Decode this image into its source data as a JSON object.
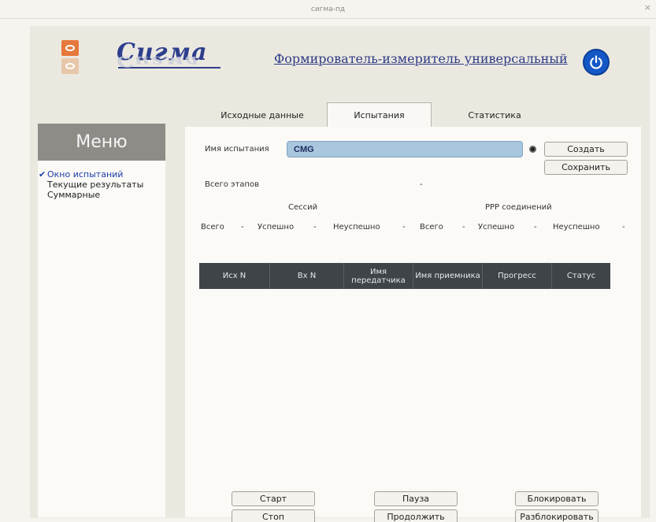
{
  "window": {
    "title": "сигма-пд",
    "close_label": "×"
  },
  "header": {
    "brand": "Сигма",
    "subtitle": "Формирователь-измеритель универсальный",
    "logo_icon": "sigma-logo-icon",
    "power_icon": "power-icon",
    "accent_color": "#1457c6"
  },
  "tabs": [
    {
      "label": "Исходные данные",
      "active": false
    },
    {
      "label": "Испытания",
      "active": true
    },
    {
      "label": "Статистика",
      "active": false
    }
  ],
  "menu": {
    "title": "Меню",
    "items": [
      {
        "label": "Окно испытаний",
        "active": true
      },
      {
        "label": "Текущие результаты",
        "active": false
      },
      {
        "label": "Суммарные",
        "active": false
      }
    ]
  },
  "test": {
    "name_label": "Имя испытания",
    "name_value": "CMG",
    "create_label": "Создать",
    "save_label": "Сохранить",
    "total_stages_label": "Всего этапов",
    "total_stages_value": "-"
  },
  "sessions": {
    "title": "Сессий",
    "total_label": "Всего",
    "total_value": "-",
    "success_label": "Успешно",
    "success_value": "-",
    "fail_label": "Неуспешно",
    "fail_value": "-"
  },
  "ppp": {
    "title": "PPP соединений",
    "total_label": "Всего",
    "total_value": "-",
    "success_label": "Успешно",
    "success_value": "-",
    "fail_label": "Неуспешно",
    "fail_value": "-"
  },
  "table": {
    "columns": [
      "Исх N",
      "Вх N",
      "Имя передатчика",
      "Имя приемника",
      "Прогресс",
      "Статус"
    ]
  },
  "controls": {
    "start": "Старт",
    "stop": "Стоп",
    "pause": "Пауза",
    "resume": "Продолжить",
    "lock": "Блокировать",
    "unlock": "Разблокировать"
  }
}
